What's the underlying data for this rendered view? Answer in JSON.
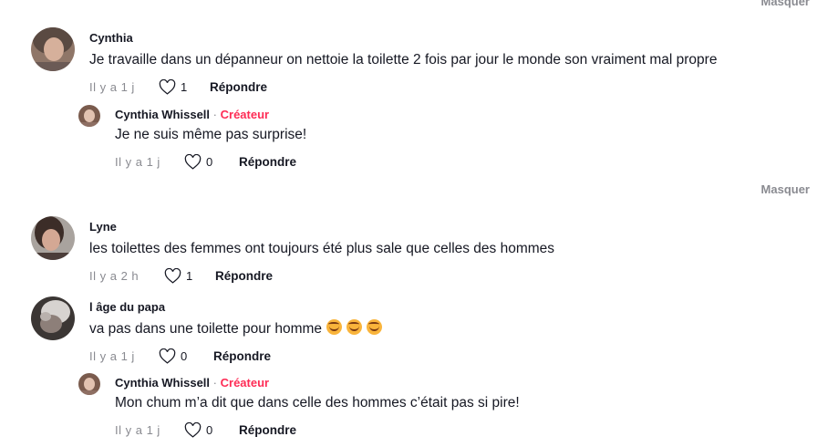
{
  "hide_label": "Masquer",
  "reply_label": "Répondre",
  "creator_separator": "·",
  "creator_label": "Créateur",
  "comments": [
    {
      "username": "Cynthia",
      "text": "Je travaille dans un dépanneur on nettoie la toilette 2 fois par jour le monde son vraiment mal propre",
      "time": "Il y a 1 j",
      "likes": "1",
      "replies": [
        {
          "username": "Cynthia Whissell",
          "text": "Je ne suis même pas surprise!",
          "time": "Il y a 1 j",
          "likes": "0"
        }
      ]
    },
    {
      "username": "Lyne",
      "text": "les toilettes des femmes ont toujours été plus sale que celles des hommes",
      "time": "Il y a 2 h",
      "likes": "1"
    },
    {
      "username": "l âge du papa",
      "text": "va pas dans une toilette pour homme",
      "emoji_icon": "grinning-sweat-emoji-icon",
      "time": "Il y a 1 j",
      "likes": "0",
      "replies": [
        {
          "username": "Cynthia Whissell",
          "text": "Mon chum m’a dit que dans celle des hommes c’était pas si pire!",
          "time": "Il y a 1 j",
          "likes": "0"
        }
      ]
    }
  ]
}
